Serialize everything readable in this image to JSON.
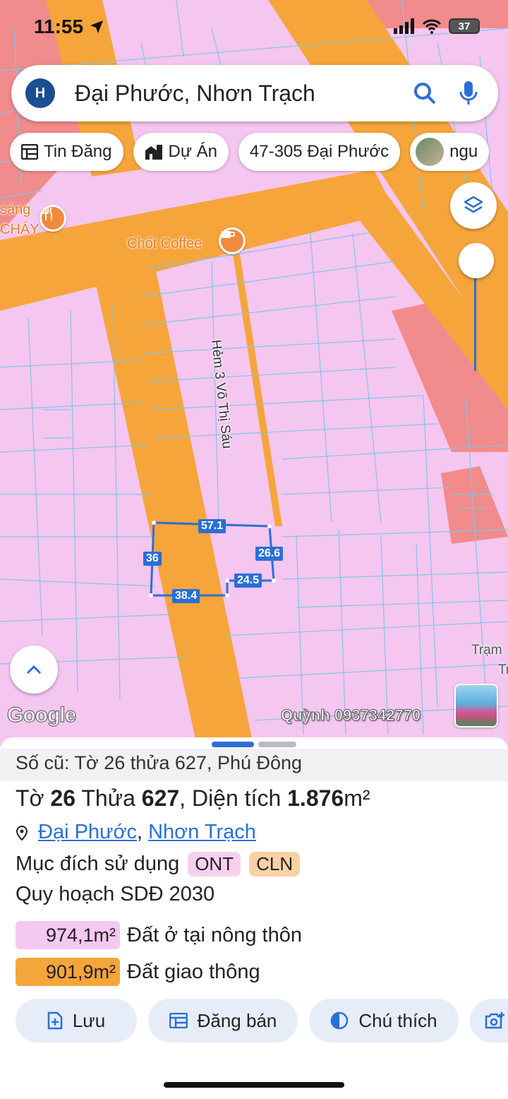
{
  "status_bar": {
    "time": "11:55",
    "battery": "37"
  },
  "search": {
    "avatar_letter": "H",
    "query": "Đại Phước, Nhơn Trạch"
  },
  "chips": [
    {
      "label": "Tin Đăng",
      "icon": "listing-icon"
    },
    {
      "label": "Dự Án",
      "icon": "project-icon"
    },
    {
      "label": "47-305 Đại Phước",
      "icon": ""
    },
    {
      "label": "ngu",
      "icon": "avatar"
    }
  ],
  "map": {
    "poi_restaurant_label_1": "sáng",
    "poi_restaurant_label_2": "CHÁY",
    "poi_cafe_label": "Chốt Coffee",
    "road_label": "Hẻm 3 Võ Thị Sáu",
    "place_label_1": "Trạm",
    "place_label_2": "Tr",
    "dimensions": {
      "top": "57.1",
      "left": "36",
      "right": "26.6",
      "inner": "24.5",
      "bottom": "38.4"
    },
    "google": "Google",
    "watermark": "Quỳnh 0937342770"
  },
  "sheet": {
    "old_info": "Số cũ: Tờ 26 thửa 627, Phú Đông",
    "title_pre1": "Tờ ",
    "title_sheet": "26",
    "title_pre2": " Thửa ",
    "title_parcel": "627",
    "title_pre3": ", Diện tích ",
    "title_area": "1.876",
    "title_unit": "m²",
    "location_ward": "Đại Phước",
    "location_district": "Nhơn Trạch",
    "usage_label": "Mục đích sử dụng",
    "usage_tags": [
      "ONT",
      "CLN"
    ],
    "plan_label": "Quy hoạch SDĐ 2030",
    "plan_items": [
      {
        "area": "974,1m²",
        "desc": "Đất ở tại nông thôn",
        "color": "#f6c7f2"
      },
      {
        "area": "901,9m²",
        "desc": "Đất giao thông",
        "color": "#f6a53b"
      }
    ]
  },
  "actions": [
    {
      "label": "Lưu",
      "icon": "add-bookmark-icon"
    },
    {
      "label": "Đăng bán",
      "icon": "listing-icon"
    },
    {
      "label": "Chú thích",
      "icon": "contrast-icon"
    },
    {
      "label": "",
      "icon": "add-photo-icon"
    }
  ],
  "colors": {
    "accent": "#2b6fd6",
    "land_residential": "#f5c6f0",
    "road": "#f6a53b"
  }
}
